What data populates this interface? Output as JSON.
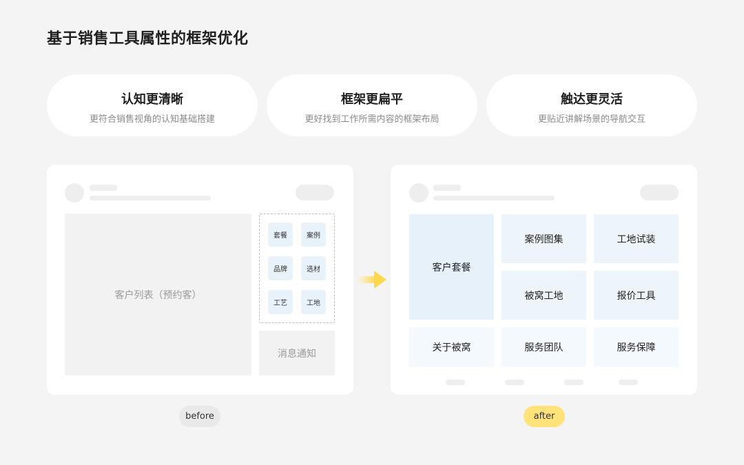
{
  "title": "基于销售工具属性的框架优化",
  "features": [
    {
      "heading": "认知更清晰",
      "sub": "更符合销售视角的认知基础搭建"
    },
    {
      "heading": "框架更扁平",
      "sub": "更好找到工作所需内容的框架布局"
    },
    {
      "heading": "触达更灵活",
      "sub": "更贴近讲解场景的导航交互"
    }
  ],
  "before": {
    "main_label": "客户列表（预约客）",
    "tools": [
      "套餐",
      "案例",
      "品牌",
      "选材",
      "工艺",
      "工地"
    ],
    "notice_label": "消息通知",
    "tag": "before"
  },
  "after": {
    "tiles": [
      "客户套餐",
      "案例图集",
      "工地试装",
      "被窝工地",
      "报价工具",
      "关于被窝",
      "服务团队",
      "服务保障"
    ],
    "tag": "after"
  },
  "colors": {
    "accent_yellow": "#ffe27a",
    "tile_blue": "#e6f1f9",
    "page_bg": "#f4f4f4"
  }
}
